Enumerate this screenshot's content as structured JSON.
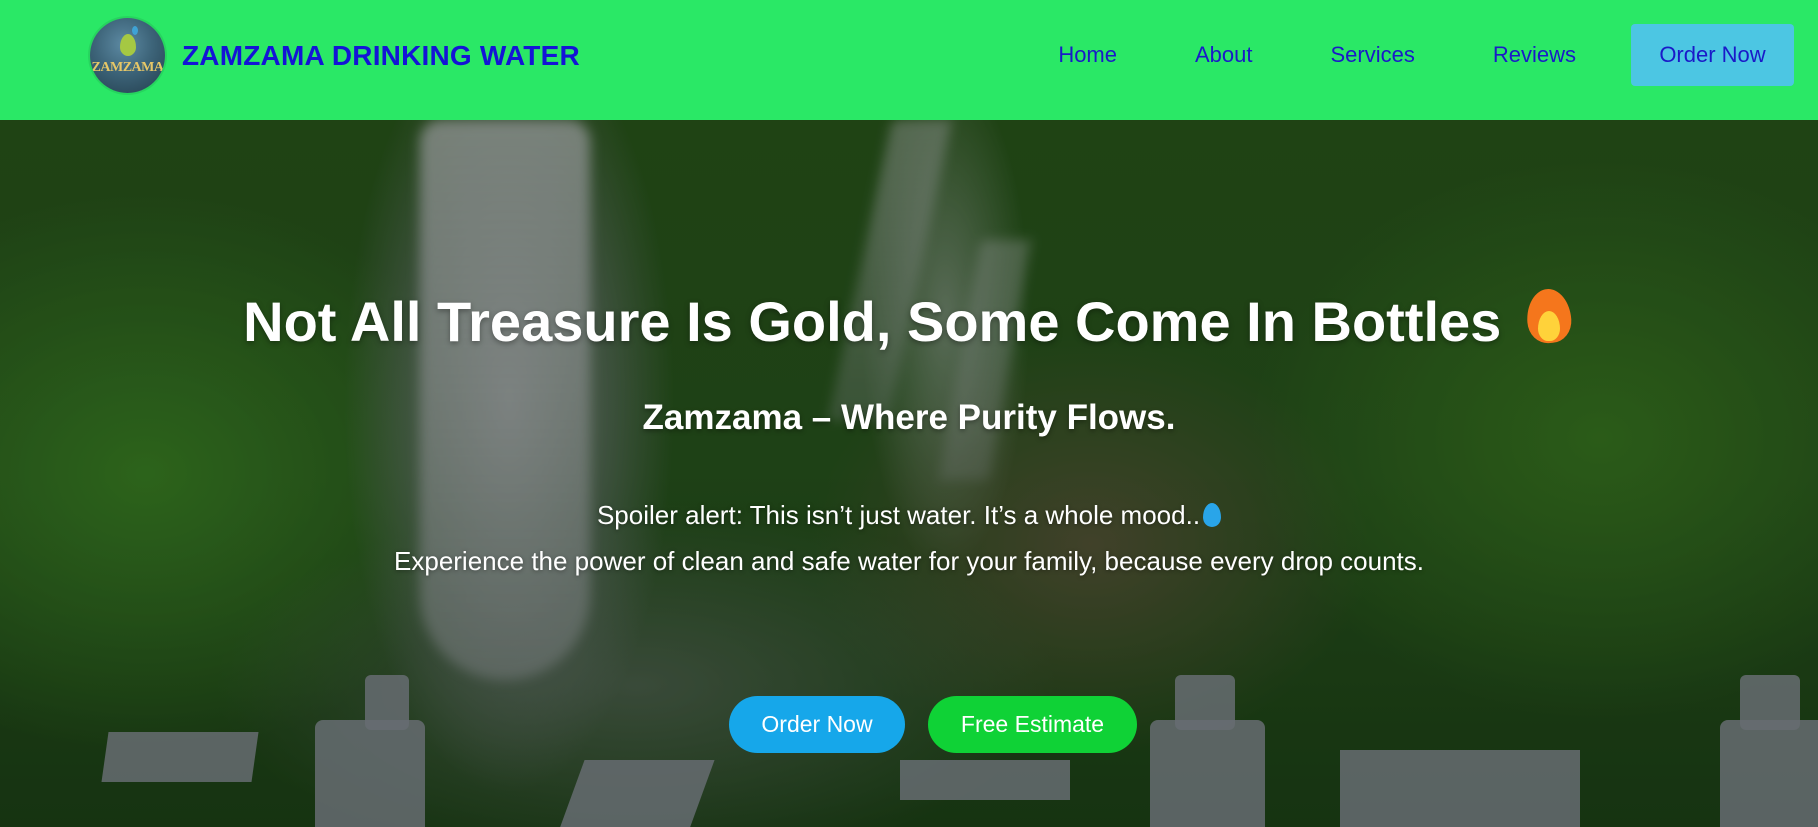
{
  "header": {
    "logo_text": "ZAMZAMA",
    "brand_title": "ZAMZAMA DRINKING WATER",
    "nav": [
      {
        "label": "Home"
      },
      {
        "label": "About"
      },
      {
        "label": "Services"
      },
      {
        "label": "Reviews"
      }
    ],
    "order_now_label": "Order Now"
  },
  "hero": {
    "title": "Not All Treasure Is Gold, Some Come In Bottles",
    "title_icon": "fire-icon",
    "subtitle": "Zamzama – Where Purity Flows.",
    "line1": "Spoiler alert: This isn’t just water. It’s a whole mood..",
    "line1_icon": "water-drop-icon",
    "line2": "Experience the power of clean and safe water for your family, because every drop counts.",
    "buttons": {
      "order_now": "Order Now",
      "free_estimate": "Free Estimate"
    }
  },
  "colors": {
    "header_bg": "#2ae866",
    "brand_text": "#1414d6",
    "nav_text": "#1a1ac8",
    "nav_cta_bg": "#4cc6e3",
    "order_button_bg": "#16a7ea",
    "estimate_button_bg": "#0fd236"
  }
}
